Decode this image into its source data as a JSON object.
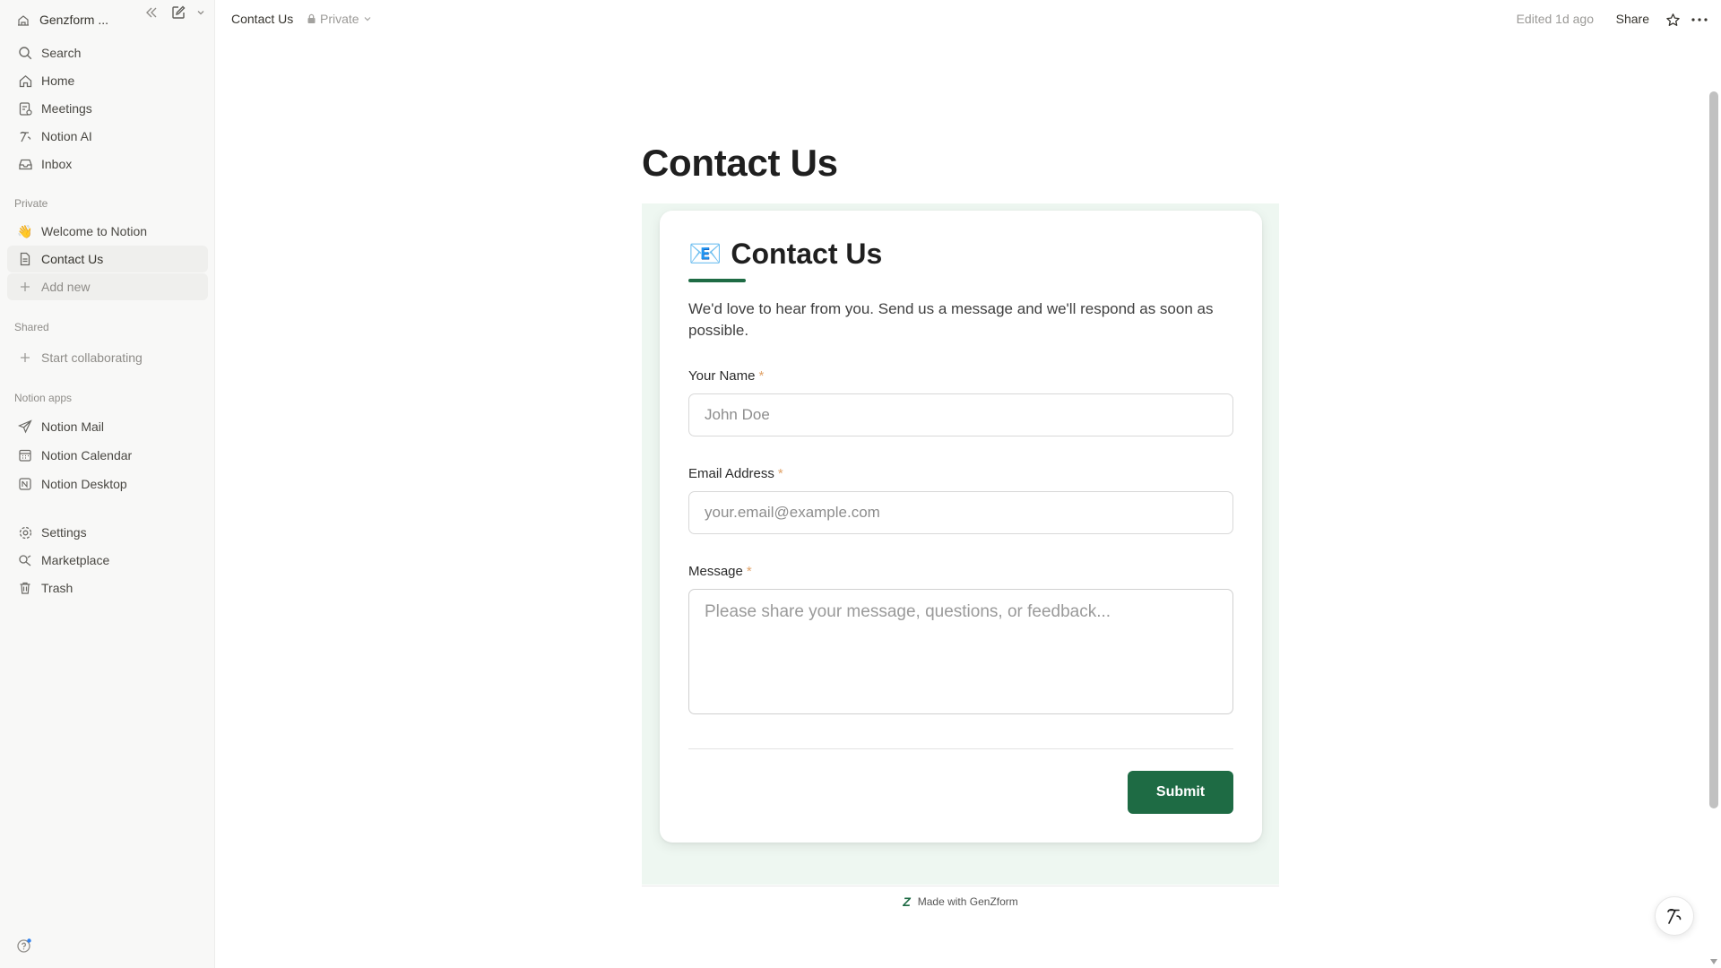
{
  "workspace": {
    "name": "Genzform ..."
  },
  "sidebar": {
    "top_items": [
      {
        "label": "Search",
        "icon": "search-icon"
      },
      {
        "label": "Home",
        "icon": "home-icon"
      },
      {
        "label": "Meetings",
        "icon": "meetings-icon"
      },
      {
        "label": "Notion AI",
        "icon": "notion-ai-icon"
      },
      {
        "label": "Inbox",
        "icon": "inbox-icon"
      }
    ],
    "private_label": "Private",
    "private_items": [
      {
        "label": "Welcome to Notion",
        "icon": "hand-wave-icon"
      },
      {
        "label": "Contact Us",
        "icon": "page-icon"
      },
      {
        "label": "Add new",
        "icon": "plus-icon"
      }
    ],
    "shared_label": "Shared",
    "shared_items": [
      {
        "label": "Start collaborating",
        "icon": "plus-icon"
      }
    ],
    "apps_label": "Notion apps",
    "app_items": [
      {
        "label": "Notion Mail",
        "icon": "mail-send-icon"
      },
      {
        "label": "Notion Calendar",
        "icon": "calendar-icon"
      },
      {
        "label": "Notion Desktop",
        "icon": "desktop-icon"
      }
    ],
    "bottom_items": [
      {
        "label": "Settings",
        "icon": "gear-icon"
      },
      {
        "label": "Marketplace",
        "icon": "marketplace-icon"
      },
      {
        "label": "Trash",
        "icon": "trash-icon"
      }
    ]
  },
  "topbar": {
    "title": "Contact Us",
    "privacy": "Private",
    "edited": "Edited 1d ago",
    "share_label": "Share"
  },
  "page": {
    "title": "Contact Us"
  },
  "form": {
    "heading": "Contact Us",
    "heading_emoji": "📧",
    "description": "We'd love to hear from you. Send us a message and we'll respond as soon as possible.",
    "fields": [
      {
        "label": "Your Name",
        "required_mark": "*",
        "placeholder": "John Doe",
        "value": ""
      },
      {
        "label": "Email Address",
        "required_mark": "*",
        "placeholder": "your.email@example.com",
        "value": ""
      },
      {
        "label": "Message",
        "required_mark": "*",
        "placeholder": "Please share your message, questions, or feedback...",
        "value": ""
      }
    ],
    "submit_label": "Submit",
    "footer_logo": "Z",
    "footer_text": "Made with GenZform"
  },
  "colors": {
    "accent": "#1e6b44",
    "embed_background": "#eef7f1",
    "sidebar_background": "#f8f8f7",
    "required_mark": "#e0a36a"
  }
}
